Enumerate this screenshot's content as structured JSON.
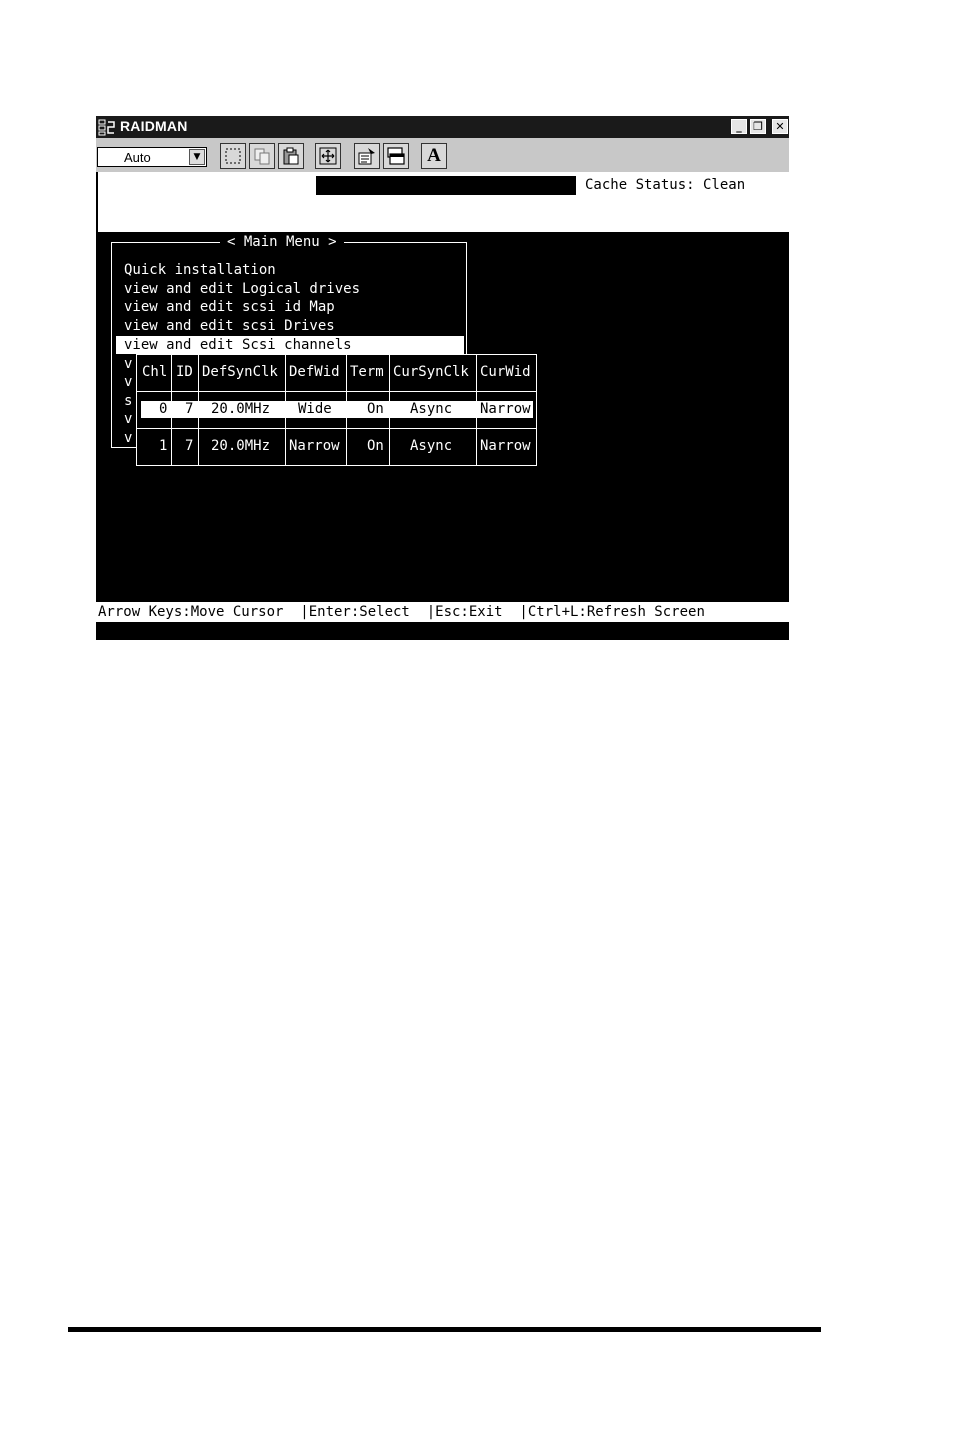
{
  "window": {
    "title": "RAIDMAN",
    "buttons": {
      "minimize": "_",
      "restore": "❐",
      "close": "✕"
    }
  },
  "toolbar": {
    "combo_value": "Auto",
    "font_button": "A",
    "icons": [
      "select-rect-icon",
      "copy-icon",
      "paste-icon",
      "fullscreen-icon",
      "properties-icon",
      "background-icon",
      "font-icon"
    ]
  },
  "status": {
    "cache_status": "Cache Status: Clean"
  },
  "main_menu": {
    "title": "< Main Menu >",
    "items": [
      "Quick installation",
      "view and edit Logical drives",
      "view and edit scsi id Map",
      "view and edit scsi Drives",
      "view and edit Scsi channels"
    ],
    "selected_index": 4,
    "side_letters": [
      "v",
      "v",
      "s",
      "v",
      "v"
    ]
  },
  "channel_table": {
    "columns": [
      "Chl",
      "ID",
      "DefSynClk",
      "DefWid",
      "Term",
      "CurSynClk",
      "CurWid"
    ],
    "rows": [
      [
        "0",
        "7",
        "20.0MHz",
        "Wide",
        "On",
        "Async",
        "Narrow"
      ],
      [
        "1",
        "7",
        "20.0MHz",
        "Narrow",
        "On",
        "Async",
        "Narrow"
      ]
    ],
    "selected_row": 0
  },
  "help_bar": {
    "text": "Arrow Keys:Move Cursor  |Enter:Select  |Esc:Exit  |Ctrl+L:Refresh Screen"
  },
  "colors": {
    "terminal_bg": "#000000",
    "terminal_fg": "#ffffff",
    "toolbar_bg": "#c8c8c8",
    "titlebar_bg": "#1a1a1a"
  }
}
